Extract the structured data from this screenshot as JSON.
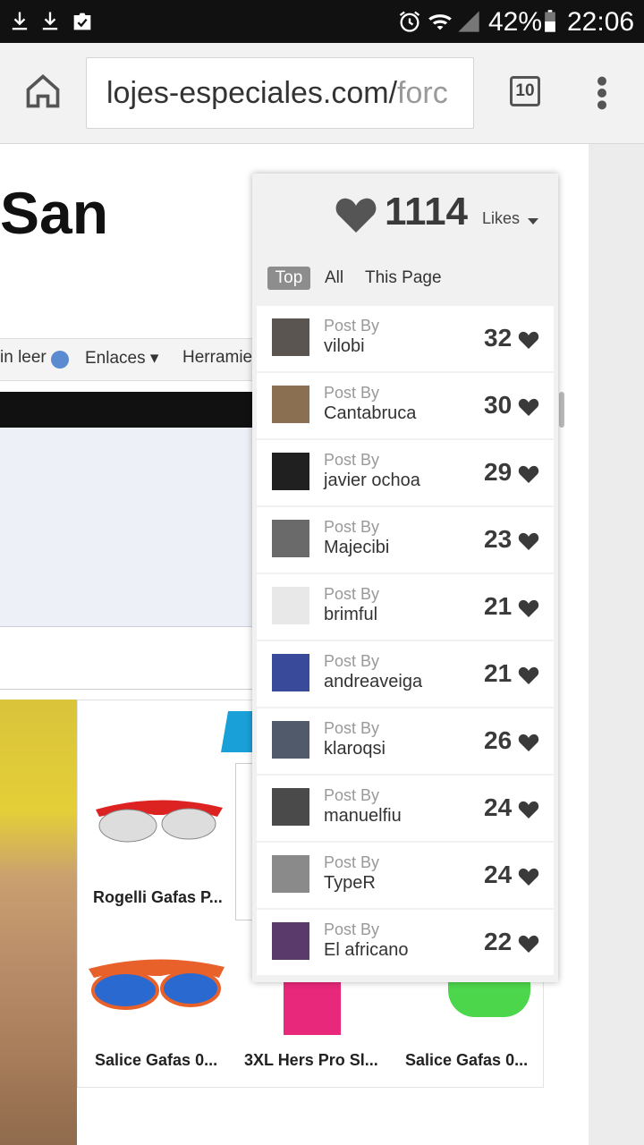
{
  "statusbar": {
    "battery": "42%",
    "time": "22:06",
    "icons": [
      "download-icon",
      "download-icon",
      "clipboard-check-icon",
      "alarm-icon",
      "wifi-icon",
      "signal-icon",
      "battery-icon"
    ]
  },
  "browser": {
    "url_main": "lojes-especiales.com/",
    "url_dim": "forc",
    "tab_count": "10",
    "icons": [
      "home-icon",
      "tabs-icon",
      "overflow-menu-icon"
    ]
  },
  "page": {
    "title_fragment": "San",
    "nav": {
      "item1": "in leer",
      "item2": "Enlaces",
      "item3": "Herramie"
    },
    "products": [
      {
        "label": "Rogelli Gafas P..."
      },
      {
        "label": "Salice Gafas 0..."
      },
      {
        "label": "3XL Hers Pro Sl..."
      },
      {
        "label": "Salice Gafas 0..."
      }
    ]
  },
  "likes": {
    "count": "1114",
    "label": "Likes",
    "tabs": [
      "Top",
      "All",
      "This Page"
    ],
    "active_tab": "Top",
    "post_by_label": "Post By",
    "rows": [
      {
        "user": "vilobi",
        "count": "32",
        "avatar_color": "#5a5550"
      },
      {
        "user": "Cantabruca",
        "count": "30",
        "avatar_color": "#8a7050"
      },
      {
        "user": "javier ochoa",
        "count": "29",
        "avatar_color": "#202020"
      },
      {
        "user": "Majecibi",
        "count": "23",
        "avatar_color": "#6a6a6a"
      },
      {
        "user": "brimful",
        "count": "21",
        "avatar_color": "#e8e8e8"
      },
      {
        "user": "andreaveiga",
        "count": "21",
        "avatar_color": "#3a4a9a"
      },
      {
        "user": "klaroqsi",
        "count": "26",
        "avatar_color": "#505a6a"
      },
      {
        "user": "manuelfiu",
        "count": "24",
        "avatar_color": "#4a4a4a"
      },
      {
        "user": "TypeR",
        "count": "24",
        "avatar_color": "#8a8a8a"
      },
      {
        "user": "El africano",
        "count": "22",
        "avatar_color": "#5a3a6a"
      }
    ]
  }
}
